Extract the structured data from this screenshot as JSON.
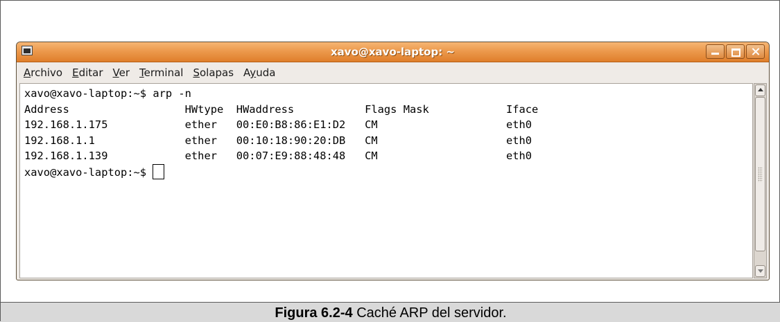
{
  "window": {
    "title": "xavo@xavo-laptop: ~"
  },
  "menubar": {
    "items": [
      {
        "mnemonic": "A",
        "rest": "rchivo"
      },
      {
        "mnemonic": "E",
        "rest": "ditar"
      },
      {
        "mnemonic": "V",
        "rest": "er"
      },
      {
        "mnemonic": "T",
        "rest": "erminal"
      },
      {
        "mnemonic": "S",
        "rest": "olapas"
      },
      {
        "pre": "A",
        "mnemonic": "y",
        "rest": "uda"
      }
    ]
  },
  "terminal": {
    "lines": [
      "xavo@xavo-laptop:~$ arp -n",
      "Address                  HWtype  HWaddress           Flags Mask            Iface",
      "192.168.1.175            ether   00:E0:B8:86:E1:D2   CM                    eth0",
      "192.168.1.1              ether   00:10:18:90:20:DB   CM                    eth0",
      "192.168.1.139            ether   00:07:E9:88:48:48   CM                    eth0"
    ],
    "prompt": "xavo@xavo-laptop:~$ "
  },
  "caption": {
    "label": "Figura 6.2-4",
    "text": " Caché ARP del servidor."
  }
}
